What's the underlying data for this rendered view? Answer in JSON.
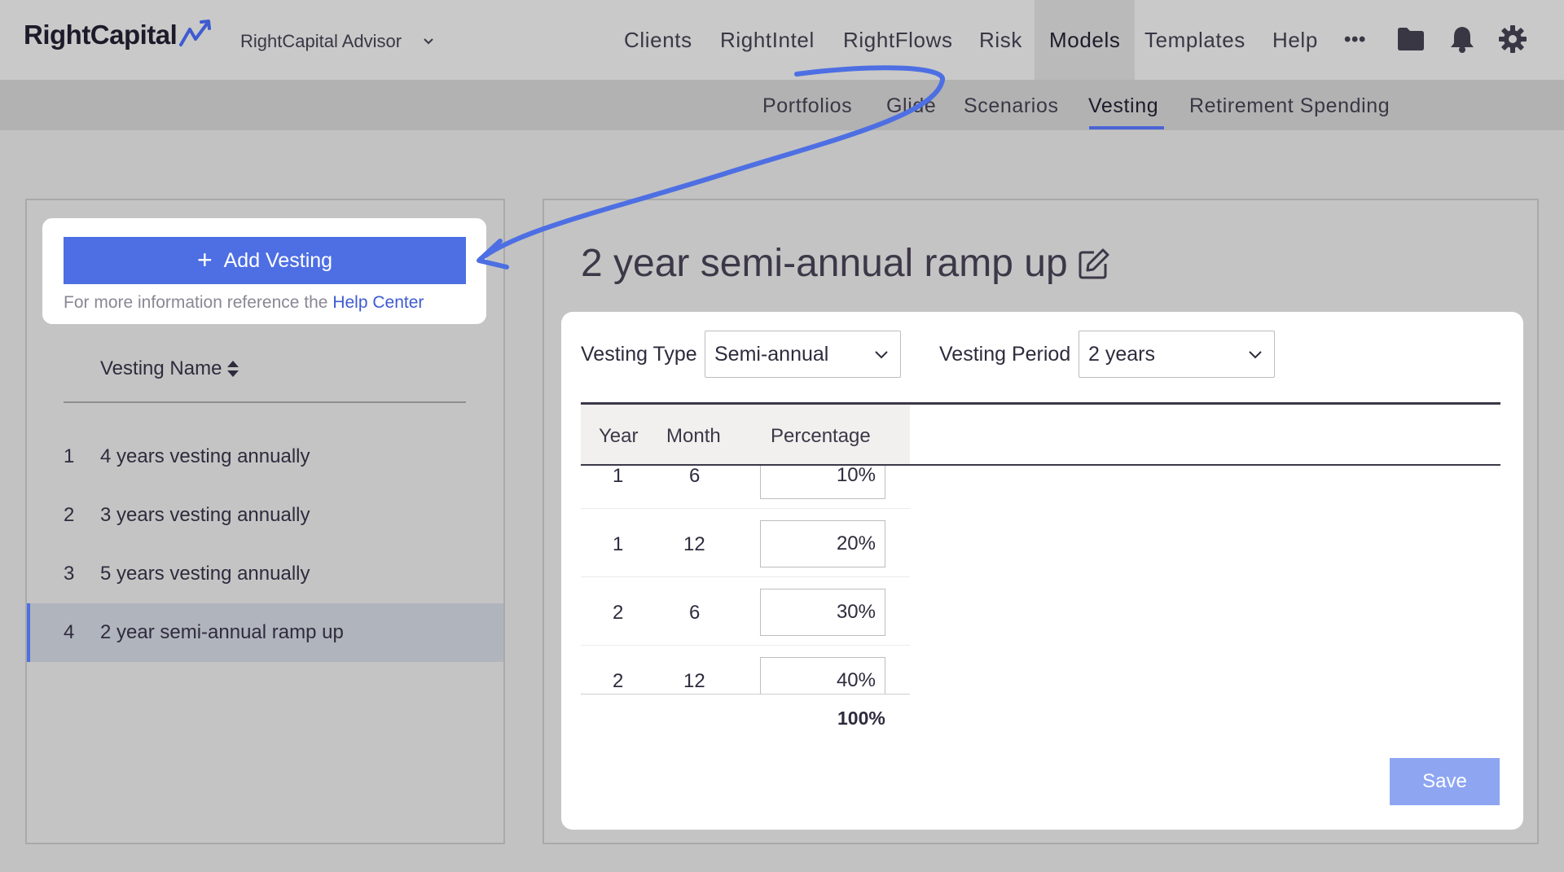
{
  "brand": {
    "logo_text": "RightCapital",
    "advisor_label": "RightCapital Advisor"
  },
  "nav": {
    "items": [
      "Clients",
      "RightIntel",
      "RightFlows",
      "Risk",
      "Models",
      "Templates",
      "Help"
    ],
    "active": "Models",
    "more_glyph": "•••",
    "icons": [
      "folder-icon",
      "bell-icon",
      "gear-icon"
    ]
  },
  "subnav": {
    "items": [
      "Portfolios",
      "Glide",
      "Scenarios",
      "Vesting",
      "Retirement Spending"
    ],
    "active": "Vesting"
  },
  "sidebar": {
    "add_button_label": "Add Vesting",
    "help_text": "For more information reference the",
    "help_link": "Help Center",
    "column_header": "Vesting Name",
    "items": [
      {
        "num": "1",
        "label": "4 years vesting annually"
      },
      {
        "num": "2",
        "label": "3 years vesting annually"
      },
      {
        "num": "3",
        "label": "5 years vesting annually"
      },
      {
        "num": "4",
        "label": "2 year semi-annual ramp up"
      }
    ],
    "selected_index": 3
  },
  "main": {
    "title": "2 year semi-annual ramp up",
    "vesting_type_label": "Vesting Type",
    "vesting_type_value": "Semi-annual",
    "vesting_period_label": "Vesting Period",
    "vesting_period_value": "2 years",
    "table": {
      "headers": [
        "Year",
        "Month",
        "Percentage"
      ],
      "rows": [
        {
          "year": "1",
          "month": "6",
          "pct": "10%"
        },
        {
          "year": "1",
          "month": "12",
          "pct": "20%"
        },
        {
          "year": "2",
          "month": "6",
          "pct": "30%"
        },
        {
          "year": "2",
          "month": "12",
          "pct": "40%"
        }
      ],
      "total": "100%"
    },
    "save_label": "Save"
  },
  "colors": {
    "accent": "#4d6fe3",
    "annotation_arrow": "#4d6fe3",
    "save_disabled": "#8ea5f2",
    "selected_row": "#b0b4bd"
  }
}
